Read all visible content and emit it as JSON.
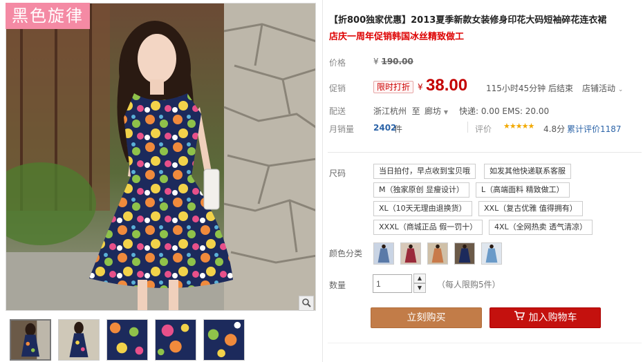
{
  "gallery": {
    "brand_badge": "黑色旋律",
    "zoom_icon": "magnifier-icon",
    "thumbnail_count": 5
  },
  "product": {
    "title": "【折800独家优惠】2013夏季新款女装修身印花大码短袖碎花连衣裙",
    "subtitle": "店庆一周年促销韩国冰丝精致做工"
  },
  "price": {
    "label": "价格",
    "currency": "¥",
    "original": "190.00"
  },
  "promo": {
    "label": "促销",
    "badge": "限时打折",
    "currency": "¥",
    "price": "38.00",
    "countdown": "115小时45分钟 后结束",
    "store_activity": "店铺活动"
  },
  "shipping": {
    "label": "配送",
    "from": "浙江杭州",
    "to_word": "至",
    "destination": "廊坊",
    "fees": "快递: 0.00 EMS: 20.00"
  },
  "sales": {
    "label": "月销量",
    "count": "2402",
    "unit": "件",
    "rating_label": "评价",
    "stars": 5,
    "score": "4.8分",
    "total_reviews": "累计评价1187"
  },
  "options": {
    "size_label": "尺码",
    "sizes": [
      "当日拍付，早点收到宝贝哦",
      "如发其他快递联系客服",
      "M（独家原创 显瘦设计）",
      "L（高端面料 精致做工）",
      "XL（10天无理由退换货）",
      "XXL（复古优雅 值得拥有）",
      "XXXL（商城正品 假一罚十）",
      "4XL（全网热卖 透气清凉）"
    ],
    "color_label": "颜色分类",
    "color_count": 5
  },
  "quantity": {
    "label": "数量",
    "value": "1",
    "limit": "（每人限购5件）"
  },
  "actions": {
    "buy_now": "立刻购买",
    "add_to_cart": "加入购物车"
  },
  "colors": {
    "price_red": "#c40000",
    "buy_button": "#c27c48",
    "cart_button": "#c4110e",
    "brand_pink": "#f48aa4",
    "link_blue": "#2c64a8"
  }
}
